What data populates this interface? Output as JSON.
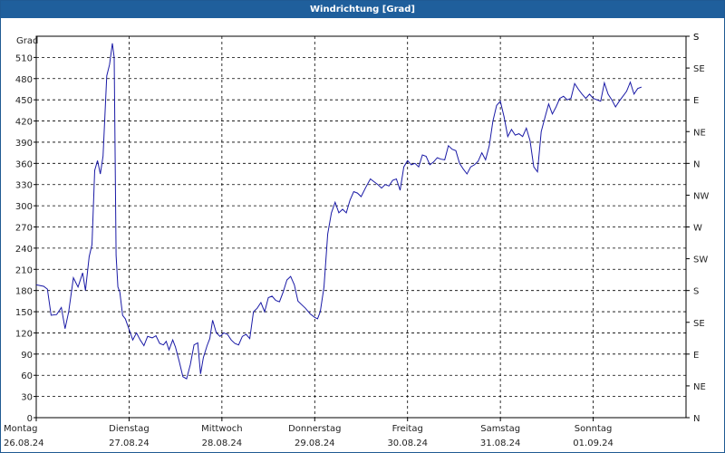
{
  "window": {
    "title": "Windrichtung [Grad]"
  },
  "chart_data": {
    "type": "line",
    "title": "Windrichtung [Grad]",
    "ylabel": "Grad",
    "ylim": [
      0,
      540
    ],
    "y_ticks": [
      0,
      30,
      60,
      90,
      120,
      150,
      180,
      210,
      240,
      270,
      300,
      330,
      360,
      390,
      420,
      450,
      480,
      510
    ],
    "compass_labels": [
      "N",
      "NE",
      "E",
      "SE",
      "S",
      "SW",
      "W",
      "NW",
      "N",
      "NE",
      "E",
      "SE",
      "S"
    ],
    "compass_top": "S",
    "grid": true,
    "x_days": [
      {
        "day": "Montag",
        "date": "26.08.24"
      },
      {
        "day": "Dienstag",
        "date": "27.08.24"
      },
      {
        "day": "Mittwoch",
        "date": "28.08.24"
      },
      {
        "day": "Donnerstag",
        "date": "29.08.24"
      },
      {
        "day": "Freitag",
        "date": "30.08.24"
      },
      {
        "day": "Samstag",
        "date": "31.08.24"
      },
      {
        "day": "Sonntag",
        "date": "01.09.24"
      }
    ],
    "xlim_days": [
      0,
      7
    ],
    "series": [
      {
        "color": "#1a1aa6",
        "points": [
          [
            0.0,
            188
          ],
          [
            0.08,
            186
          ],
          [
            0.12,
            182
          ],
          [
            0.16,
            145
          ],
          [
            0.22,
            146
          ],
          [
            0.27,
            156
          ],
          [
            0.31,
            126
          ],
          [
            0.35,
            150
          ],
          [
            0.4,
            198
          ],
          [
            0.45,
            185
          ],
          [
            0.5,
            205
          ],
          [
            0.53,
            180
          ],
          [
            0.57,
            228
          ],
          [
            0.6,
            245
          ],
          [
            0.63,
            350
          ],
          [
            0.66,
            364
          ],
          [
            0.69,
            345
          ],
          [
            0.72,
            370
          ],
          [
            0.76,
            484
          ],
          [
            0.79,
            500
          ],
          [
            0.82,
            530
          ],
          [
            0.84,
            510
          ],
          [
            0.86,
            230
          ],
          [
            0.88,
            185
          ],
          [
            0.9,
            178
          ],
          [
            0.93,
            145
          ],
          [
            0.96,
            140
          ],
          [
            1.0,
            125
          ],
          [
            1.04,
            110
          ],
          [
            1.08,
            120
          ],
          [
            1.12,
            110
          ],
          [
            1.16,
            102
          ],
          [
            1.2,
            115
          ],
          [
            1.25,
            113
          ],
          [
            1.29,
            116
          ],
          [
            1.33,
            105
          ],
          [
            1.37,
            103
          ],
          [
            1.4,
            108
          ],
          [
            1.43,
            96
          ],
          [
            1.47,
            110
          ],
          [
            1.5,
            100
          ],
          [
            1.54,
            80
          ],
          [
            1.58,
            58
          ],
          [
            1.62,
            55
          ],
          [
            1.66,
            75
          ],
          [
            1.7,
            103
          ],
          [
            1.74,
            106
          ],
          [
            1.77,
            62
          ],
          [
            1.8,
            85
          ],
          [
            1.84,
            102
          ],
          [
            1.87,
            112
          ],
          [
            1.9,
            138
          ],
          [
            1.94,
            120
          ],
          [
            1.98,
            115
          ],
          [
            2.02,
            120
          ],
          [
            2.06,
            118
          ],
          [
            2.1,
            110
          ],
          [
            2.14,
            105
          ],
          [
            2.18,
            103
          ],
          [
            2.22,
            115
          ],
          [
            2.26,
            118
          ],
          [
            2.3,
            112
          ],
          [
            2.34,
            150
          ],
          [
            2.38,
            155
          ],
          [
            2.42,
            163
          ],
          [
            2.46,
            150
          ],
          [
            2.5,
            170
          ],
          [
            2.54,
            172
          ],
          [
            2.58,
            166
          ],
          [
            2.62,
            164
          ],
          [
            2.66,
            178
          ],
          [
            2.7,
            195
          ],
          [
            2.74,
            200
          ],
          [
            2.78,
            188
          ],
          [
            2.82,
            165
          ],
          [
            2.86,
            160
          ],
          [
            2.9,
            155
          ],
          [
            2.95,
            147
          ],
          [
            3.0,
            142
          ],
          [
            3.03,
            140
          ],
          [
            3.06,
            150
          ],
          [
            3.1,
            185
          ],
          [
            3.14,
            260
          ],
          [
            3.18,
            290
          ],
          [
            3.22,
            305
          ],
          [
            3.26,
            290
          ],
          [
            3.3,
            295
          ],
          [
            3.34,
            290
          ],
          [
            3.38,
            308
          ],
          [
            3.42,
            320
          ],
          [
            3.46,
            318
          ],
          [
            3.5,
            313
          ],
          [
            3.55,
            326
          ],
          [
            3.6,
            338
          ],
          [
            3.64,
            334
          ],
          [
            3.68,
            330
          ],
          [
            3.72,
            325
          ],
          [
            3.76,
            330
          ],
          [
            3.8,
            328
          ],
          [
            3.84,
            336
          ],
          [
            3.88,
            338
          ],
          [
            3.92,
            322
          ],
          [
            3.96,
            355
          ],
          [
            4.0,
            364
          ],
          [
            4.04,
            358
          ],
          [
            4.08,
            360
          ],
          [
            4.12,
            355
          ],
          [
            4.16,
            372
          ],
          [
            4.2,
            370
          ],
          [
            4.24,
            358
          ],
          [
            4.28,
            362
          ],
          [
            4.32,
            368
          ],
          [
            4.36,
            366
          ],
          [
            4.4,
            365
          ],
          [
            4.44,
            385
          ],
          [
            4.48,
            380
          ],
          [
            4.52,
            378
          ],
          [
            4.56,
            360
          ],
          [
            4.6,
            352
          ],
          [
            4.64,
            345
          ],
          [
            4.68,
            355
          ],
          [
            4.72,
            358
          ],
          [
            4.76,
            363
          ],
          [
            4.8,
            375
          ],
          [
            4.84,
            365
          ],
          [
            4.88,
            385
          ],
          [
            4.92,
            420
          ],
          [
            4.96,
            442
          ],
          [
            5.0,
            448
          ],
          [
            5.04,
            426
          ],
          [
            5.08,
            398
          ],
          [
            5.12,
            408
          ],
          [
            5.16,
            400
          ],
          [
            5.2,
            402
          ],
          [
            5.24,
            398
          ],
          [
            5.28,
            410
          ],
          [
            5.32,
            392
          ],
          [
            5.36,
            355
          ],
          [
            5.4,
            348
          ],
          [
            5.44,
            405
          ],
          [
            5.48,
            425
          ],
          [
            5.52,
            444
          ],
          [
            5.56,
            430
          ],
          [
            5.6,
            440
          ],
          [
            5.64,
            452
          ],
          [
            5.68,
            455
          ],
          [
            5.72,
            450
          ],
          [
            5.76,
            452
          ],
          [
            5.8,
            473
          ],
          [
            5.84,
            465
          ],
          [
            5.88,
            458
          ],
          [
            5.92,
            452
          ],
          [
            5.96,
            458
          ],
          [
            6.0,
            452
          ],
          [
            6.04,
            450
          ],
          [
            6.08,
            448
          ],
          [
            6.12,
            474
          ],
          [
            6.16,
            458
          ],
          [
            6.2,
            450
          ],
          [
            6.24,
            440
          ],
          [
            6.28,
            448
          ],
          [
            6.32,
            455
          ],
          [
            6.36,
            462
          ],
          [
            6.4,
            475
          ],
          [
            6.44,
            458
          ],
          [
            6.48,
            466
          ],
          [
            6.52,
            468
          ]
        ]
      }
    ]
  }
}
